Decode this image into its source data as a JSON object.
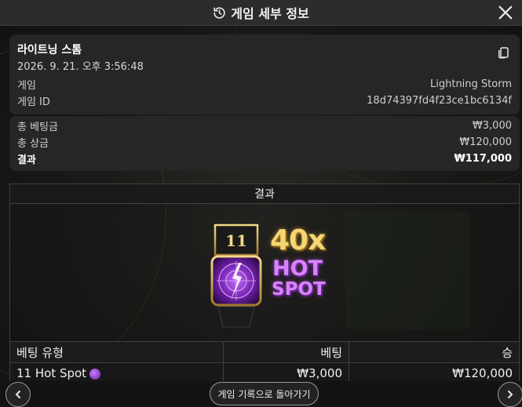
{
  "header": {
    "title": "게임 세부 정보"
  },
  "game": {
    "name": "라이트닝 스톰",
    "datetime": "2026. 9. 21. 오후 3:56:48",
    "game_label": "게임",
    "game_value": "Lightning Storm",
    "id_label": "게임 ID",
    "id_value": "18d74397fd4f23ce1bc6134f"
  },
  "summary": {
    "total_bet_label": "총 베팅금",
    "total_bet_value": "₩3,000",
    "total_win_label": "총 상금",
    "total_win_value": "₩120,000",
    "result_label": "결과",
    "result_value": "₩117,000"
  },
  "result": {
    "heading": "결과",
    "hotspot_number": "11",
    "multiplier": "40x",
    "hot_text": "HOT",
    "spot_text": "SPOT"
  },
  "bets": {
    "headers": {
      "type": "베팅 유형",
      "bet": "베팅",
      "win": "승"
    },
    "rows": [
      {
        "type": "11 Hot Spot",
        "bet": "₩3,000",
        "win": "₩120,000"
      }
    ]
  },
  "footer": {
    "back_label": "게임 기록으로 돌아가기"
  },
  "icons": {
    "history": "history-icon",
    "close": "close-icon",
    "copy": "copy-icon",
    "prev": "chevron-left-icon",
    "next": "chevron-right-icon"
  },
  "colors": {
    "header_bg": "#2c2c2c",
    "card_bg": "#262626",
    "multiplier": "#f5d673",
    "hot_spot": "#d983ff"
  }
}
